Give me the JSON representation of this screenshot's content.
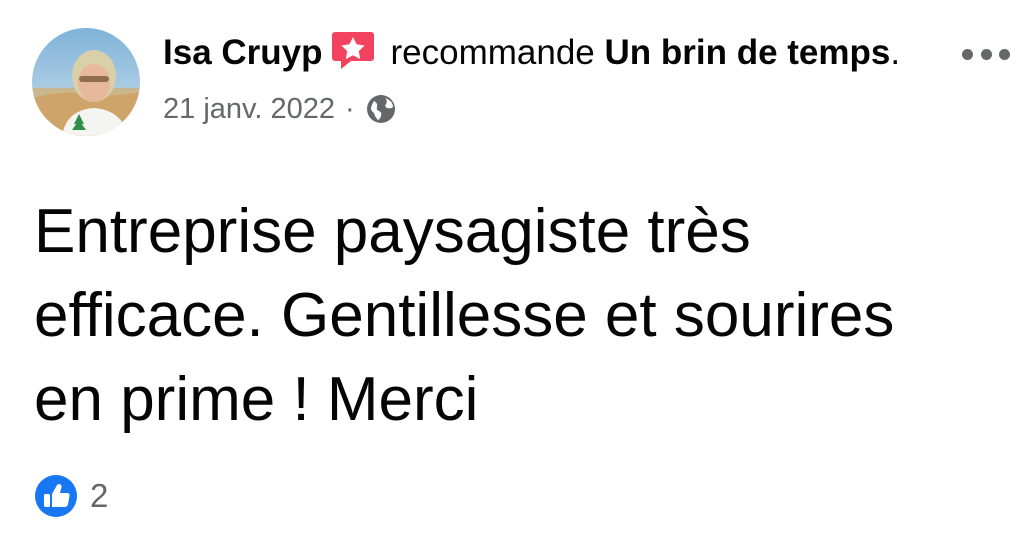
{
  "post": {
    "author": "Isa Cruyp",
    "action_text": "recommande",
    "page_name": "Un brin de temps",
    "page_suffix": ".",
    "date": "21 janv. 2022",
    "separator": "·",
    "audience_icon": "globe-icon",
    "body": "Entreprise paysagiste très efficace. Gentillesse et sourires en prime ! Merci",
    "reactions": {
      "icon": "like-icon",
      "count": "2"
    }
  },
  "colors": {
    "recommend_badge": "#f3425f",
    "like_blue": "#1877f2",
    "secondary_text": "#65676b"
  }
}
